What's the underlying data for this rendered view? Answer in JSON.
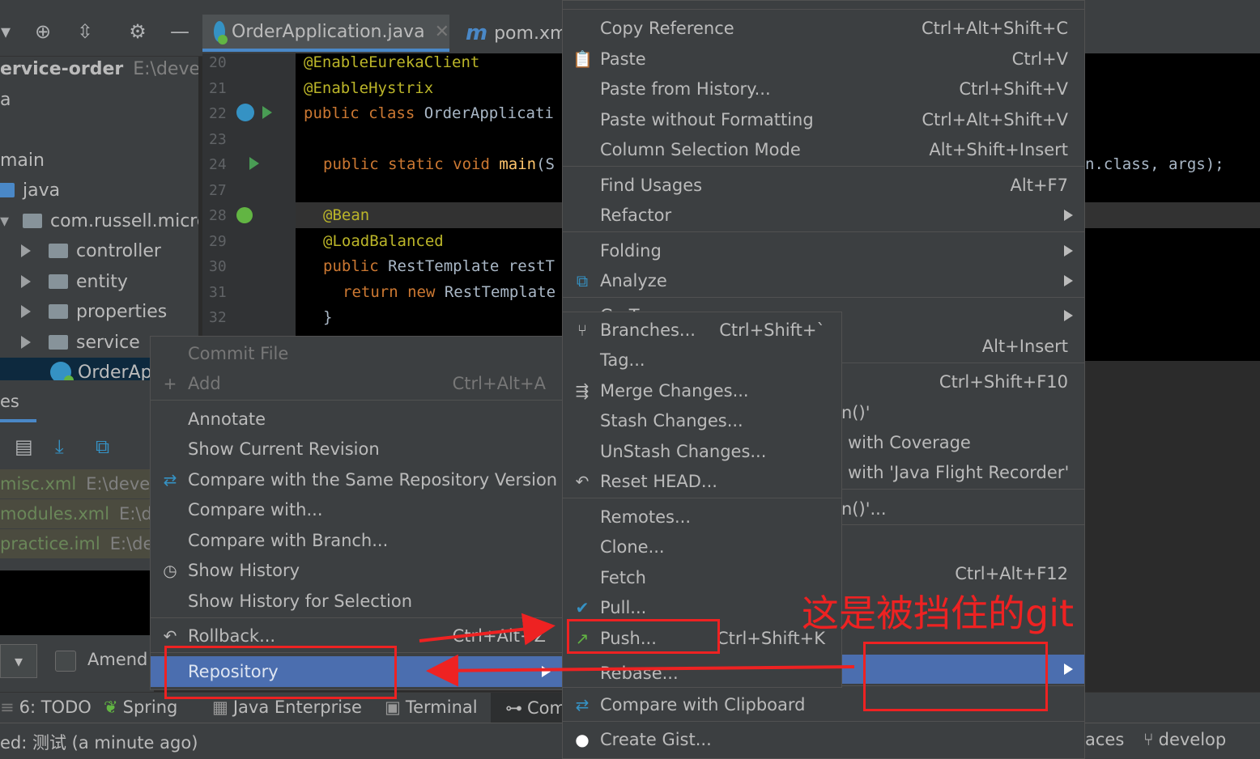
{
  "editor_tabs": [
    {
      "label": "OrderApplication.java",
      "active": true
    },
    {
      "label": "pom.xml",
      "active": false
    }
  ],
  "project": {
    "root": "ervice-order",
    "root_path": "E:\\develop",
    "rows": [
      "a",
      "main",
      "java",
      "com.russell.micros",
      "controller",
      "entity",
      "properties",
      "service",
      "OrderAp"
    ]
  },
  "code": {
    "line_numbers": [
      "20",
      "21",
      "22",
      "23",
      "24",
      "27",
      "28",
      "29",
      "30",
      "31",
      "32"
    ],
    "l20": "@EnableEurekaClient",
    "l21": "@EnableHystrix",
    "l22_kw": "public class ",
    "l22_name": "OrderApplicati",
    "l24_kw": "public static void ",
    "l24_fn": "main",
    "l24_rest": "(S",
    "l24_tail": "n.class, args);",
    "l28": "@Bean",
    "l29": "@LoadBalanced",
    "l30_kw": "public ",
    "l30_rest": "RestTemplate restT",
    "l31_kw": "return new ",
    "l31_rest": "RestTemplate",
    "l32": "}"
  },
  "vcs_panel": {
    "tab": "es",
    "files": [
      {
        "name": "misc.xml",
        "path": "E:\\develo"
      },
      {
        "name": "modules.xml",
        "path": "E:\\de"
      },
      {
        "name": "practice.iml",
        "path": "E:\\dev"
      }
    ],
    "amend_label": "Amend"
  },
  "tool_windows": [
    "6: TODO",
    "Spring",
    "Java Enterprise",
    "Terminal",
    "Com"
  ],
  "status": {
    "left": "ed: 测试 (a minute ago)",
    "right_partial": "aces",
    "branch": "develop"
  },
  "git_menu": [
    {
      "label": "Commit File",
      "shortcut": "",
      "disabled": true
    },
    {
      "label": "Add",
      "shortcut": "Ctrl+Alt+A",
      "disabled": true,
      "icon": "plus-icon"
    },
    {
      "label": "Annotate",
      "shortcut": ""
    },
    {
      "label": "Show Current Revision",
      "shortcut": ""
    },
    {
      "label": "Compare with the Same Repository Version",
      "shortcut": "",
      "icon": "compare-icon"
    },
    {
      "label": "Compare with...",
      "shortcut": ""
    },
    {
      "label": "Compare with Branch...",
      "shortcut": ""
    },
    {
      "label": "Show History",
      "shortcut": "",
      "icon": "clock-icon"
    },
    {
      "label": "Show History for Selection",
      "shortcut": ""
    },
    {
      "label": "Rollback...",
      "shortcut": "Ctrl+Alt+Z",
      "icon": "rollback-icon"
    },
    {
      "label": "Repository",
      "shortcut": "",
      "submenu": true,
      "selected": true
    }
  ],
  "editor_menu": [
    {
      "label": "Copy Reference",
      "shortcut": "Ctrl+Alt+Shift+C"
    },
    {
      "label": "Paste",
      "shortcut": "Ctrl+V",
      "icon": "clipboard-icon"
    },
    {
      "label": "Paste from History...",
      "shortcut": "Ctrl+Shift+V"
    },
    {
      "label": "Paste without Formatting",
      "shortcut": "Ctrl+Alt+Shift+V"
    },
    {
      "label": "Column Selection Mode",
      "shortcut": "Alt+Shift+Insert"
    },
    {
      "label": "Find Usages",
      "shortcut": "Alt+F7"
    },
    {
      "label": "Refactor",
      "shortcut": "",
      "submenu": true
    },
    {
      "label": "Folding",
      "shortcut": "",
      "submenu": true
    },
    {
      "label": "Analyze",
      "shortcut": "",
      "submenu": true,
      "icon": "analyze-icon"
    },
    {
      "label": "Go To",
      "shortcut": "",
      "submenu": true
    },
    {
      "label": "",
      "shortcut": "Alt+Insert"
    },
    {
      "label": "",
      "shortcut": "Ctrl+Shift+F10"
    },
    {
      "label": "n()'",
      "shortcut": ""
    },
    {
      "label": "with Coverage",
      "shortcut": ""
    },
    {
      "label": "with 'Java Flight Recorder'",
      "shortcut": ""
    },
    {
      "label": "n()'...",
      "shortcut": ""
    },
    {
      "label": "",
      "shortcut": "Ctrl+Alt+F12"
    },
    {
      "label": "Compare with Clipboard",
      "shortcut": "",
      "icon": "compare-clipboard-icon"
    },
    {
      "label": "Create Gist...",
      "shortcut": "",
      "icon": "github-icon"
    }
  ],
  "repo_menu": [
    {
      "label": "Branches...",
      "shortcut": "Ctrl+Shift+`",
      "icon": "branch-icon"
    },
    {
      "label": "Tag...",
      "shortcut": ""
    },
    {
      "label": "Merge Changes...",
      "shortcut": "",
      "icon": "merge-icon"
    },
    {
      "label": "Stash Changes...",
      "shortcut": ""
    },
    {
      "label": "UnStash Changes...",
      "shortcut": ""
    },
    {
      "label": "Reset HEAD...",
      "shortcut": "",
      "icon": "reset-icon"
    },
    {
      "label": "Remotes...",
      "shortcut": ""
    },
    {
      "label": "Clone...",
      "shortcut": ""
    },
    {
      "label": "Fetch",
      "shortcut": ""
    },
    {
      "label": "Pull...",
      "shortcut": "",
      "icon": "pull-icon"
    },
    {
      "label": "Push...",
      "shortcut": "Ctrl+Shift+K",
      "icon": "push-icon"
    },
    {
      "label": "Rebase...",
      "shortcut": ""
    }
  ],
  "annotation": {
    "text": "这是被挡住的git",
    "color": "#ee2222"
  },
  "colors": {
    "menu_bg": "#3c3f41",
    "selection": "#4b6eaf",
    "editor_bg": "#000000",
    "keyword": "#cc7832",
    "annotation": "#bbb529"
  }
}
